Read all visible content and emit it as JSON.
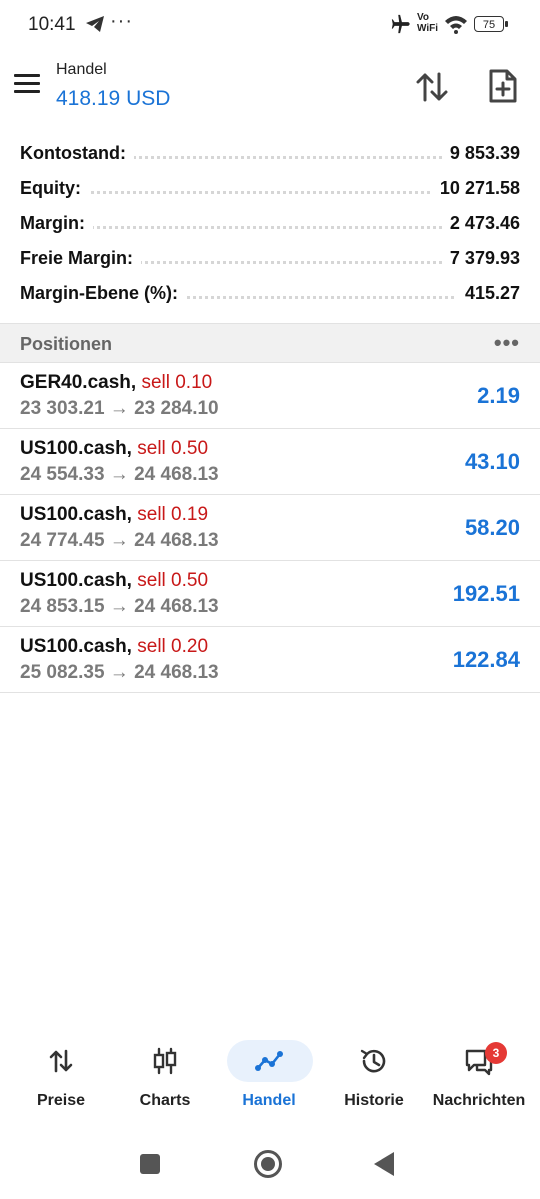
{
  "status": {
    "time": "10:41",
    "dots": "···",
    "vo": "Vo",
    "wifi_label": "WiFi",
    "battery": "75"
  },
  "header": {
    "title": "Handel",
    "balance": "418.19 USD"
  },
  "summary": [
    {
      "label": "Kontostand:",
      "value": "9 853.39"
    },
    {
      "label": "Equity:",
      "value": "10 271.58"
    },
    {
      "label": "Margin:",
      "value": "2 473.46"
    },
    {
      "label": "Freie Margin:",
      "value": "7 379.93"
    },
    {
      "label": "Margin-Ebene (%):",
      "value": "415.27"
    }
  ],
  "positions": {
    "header": "Positionen",
    "more": "•••",
    "items": [
      {
        "symbol": "GER40.cash,",
        "side": "sell 0.10",
        "prices": "23 303.21 → 23 284.10",
        "profit": "2.19"
      },
      {
        "symbol": "US100.cash,",
        "side": "sell 0.50",
        "prices": "24 554.33 → 24 468.13",
        "profit": "43.10"
      },
      {
        "symbol": "US100.cash,",
        "side": "sell 0.19",
        "prices": "24 774.45 → 24 468.13",
        "profit": "58.20"
      },
      {
        "symbol": "US100.cash,",
        "side": "sell 0.50",
        "prices": "24 853.15 → 24 468.13",
        "profit": "192.51"
      },
      {
        "symbol": "US100.cash,",
        "side": "sell 0.20",
        "prices": "25 082.35 → 24 468.13",
        "profit": "122.84"
      }
    ]
  },
  "nav": {
    "items": [
      {
        "label": "Preise",
        "icon": "quotes-arrows-icon"
      },
      {
        "label": "Charts",
        "icon": "candlestick-icon"
      },
      {
        "label": "Handel",
        "icon": "trade-line-icon",
        "active": true
      },
      {
        "label": "Historie",
        "icon": "history-clock-icon"
      },
      {
        "label": "Nachrichten",
        "icon": "messages-icon",
        "badge": "3"
      }
    ]
  },
  "colors": {
    "accent": "#1a73d6",
    "sell": "#c81818",
    "badge": "#e53935"
  }
}
